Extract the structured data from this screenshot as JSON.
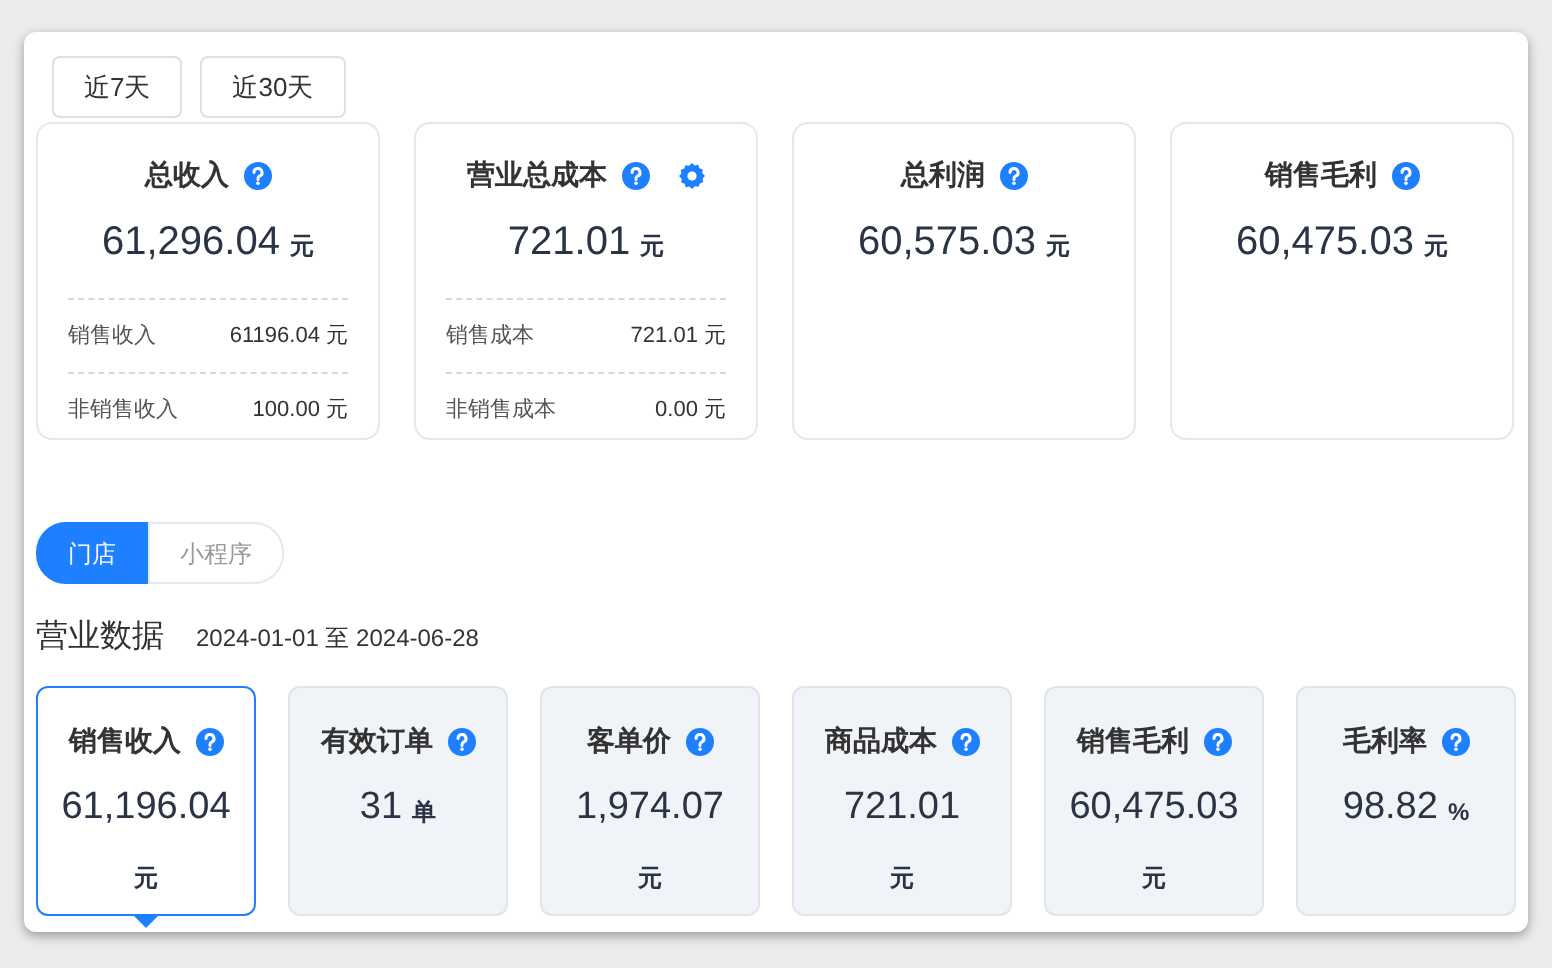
{
  "period_buttons": [
    {
      "label": "近7天"
    },
    {
      "label": "近30天"
    }
  ],
  "summary_cards": [
    {
      "title": "总收入",
      "settings": false,
      "value": "61,296.04",
      "unit": "元",
      "details": [
        {
          "label": "销售收入",
          "value": "61196.04 元"
        },
        {
          "label": "非销售收入",
          "value": "100.00 元"
        }
      ]
    },
    {
      "title": "营业总成本",
      "settings": true,
      "value": "721.01",
      "unit": "元",
      "details": [
        {
          "label": "销售成本",
          "value": "721.01 元"
        },
        {
          "label": "非销售成本",
          "value": "0.00 元"
        }
      ]
    },
    {
      "title": "总利润",
      "settings": false,
      "value": "60,575.03",
      "unit": "元"
    },
    {
      "title": "销售毛利",
      "settings": false,
      "value": "60,475.03",
      "unit": "元"
    }
  ],
  "channel_tabs": [
    {
      "label": "门店",
      "selected": true
    },
    {
      "label": "小程序",
      "selected": false
    }
  ],
  "section": {
    "title": "营业数据",
    "date_range": "2024-01-01 至 2024-06-28"
  },
  "metric_cards": [
    {
      "title": "销售收入",
      "value": "61,196.04",
      "unit": "元",
      "unit_on_new_line": true,
      "selected": true
    },
    {
      "title": "有效订单",
      "value": "31",
      "unit": "单",
      "unit_on_new_line": false,
      "selected": false
    },
    {
      "title": "客单价",
      "value": "1,974.07",
      "unit": "元",
      "unit_on_new_line": true,
      "selected": false
    },
    {
      "title": "商品成本",
      "value": "721.01",
      "unit": "元",
      "unit_on_new_line": true,
      "selected": false
    },
    {
      "title": "销售毛利",
      "value": "60,475.03",
      "unit": "元",
      "unit_on_new_line": true,
      "selected": false
    },
    {
      "title": "毛利率",
      "value": "98.82",
      "unit": "%",
      "unit_on_new_line": false,
      "selected": false
    }
  ]
}
